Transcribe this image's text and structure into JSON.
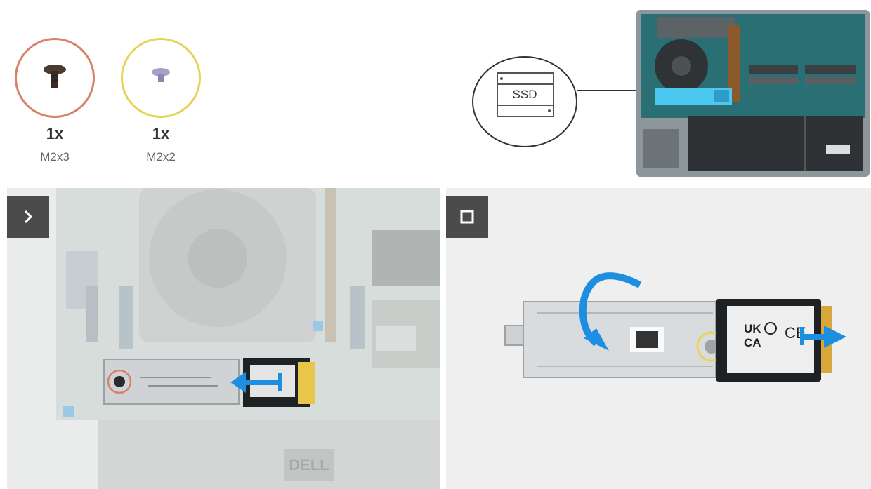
{
  "screws": [
    {
      "quantity": "1x",
      "size": "M2x3",
      "ring_color": "#d9826a"
    },
    {
      "quantity": "1x",
      "size": "M2x2",
      "ring_color": "#e8d35a"
    }
  ],
  "component_callout": {
    "label": "SSD",
    "icon": "ssd-icon"
  },
  "steps": [
    {
      "icon": "chevron-right-icon",
      "name": "step-next"
    },
    {
      "icon": "square-stop-icon",
      "name": "step-end"
    }
  ],
  "ssd_labels": {
    "brand_logo": "DELL",
    "cert_line1": "UK",
    "cert_line2": "CA",
    "ce_mark": "CE"
  },
  "colors": {
    "arrow_blue": "#1e8fe0",
    "ssd_highlight": "#4ac8f0",
    "board_green": "#1f6b6b",
    "panel_bg": "#efefef",
    "badge_bg": "#4b4b4b"
  }
}
